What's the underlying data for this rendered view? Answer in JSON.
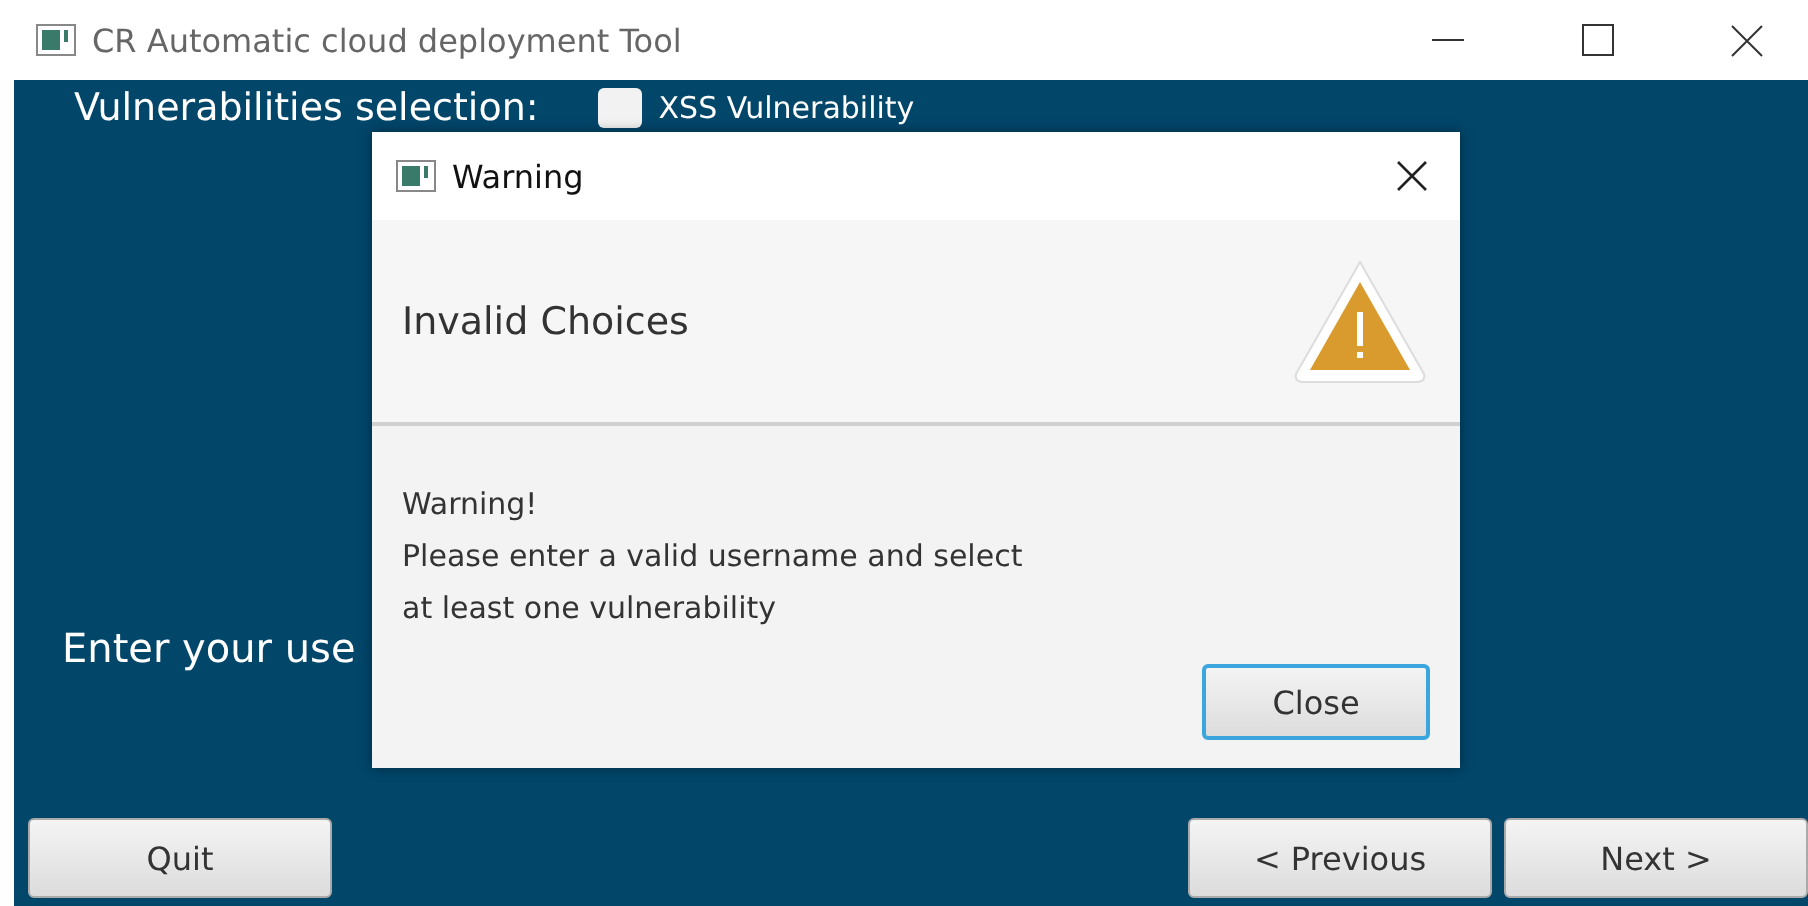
{
  "window": {
    "title": "CR Automatic cloud deployment Tool"
  },
  "main": {
    "vulnerabilities_label": "Vulnerabilities selection:",
    "checkboxes": [
      {
        "label": "XSS Vulnerability",
        "checked": false
      }
    ],
    "username_label": "Enter your use"
  },
  "buttons": {
    "left": [
      "Quit"
    ],
    "right": [
      "< Previous",
      "Next >"
    ]
  },
  "dialog": {
    "title": "Warning",
    "header": "Invalid Choices",
    "message_lines": [
      "Warning!",
      "Please enter a valid username and select",
      "at least one vulnerability"
    ],
    "button": "Close"
  }
}
